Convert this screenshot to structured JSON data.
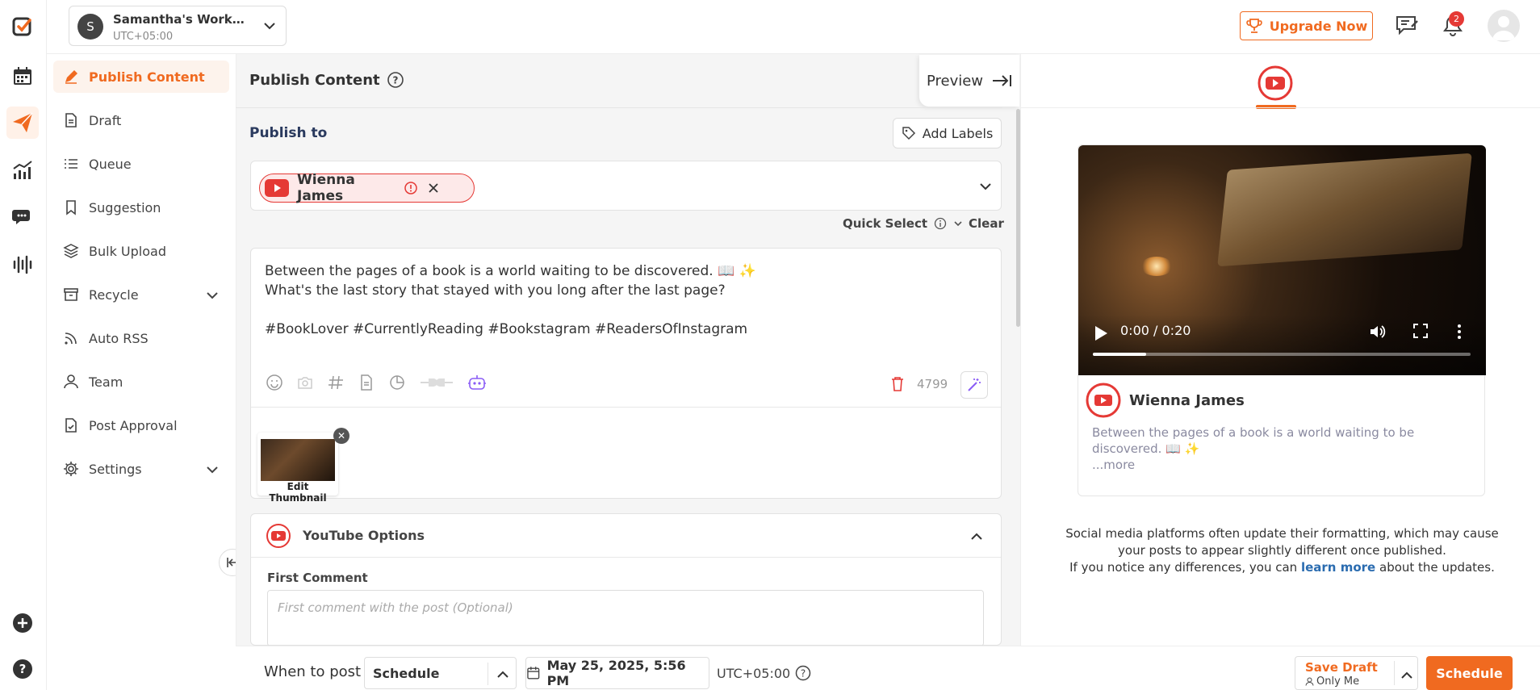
{
  "workspace": {
    "avatar_letter": "S",
    "name": "Samantha's Worksp...",
    "timezone": "UTC+05:00"
  },
  "header": {
    "upgrade_label": "Upgrade Now",
    "notification_count": "2"
  },
  "sidebar": {
    "items": [
      {
        "label": "Publish Content",
        "icon": "pencil-icon"
      },
      {
        "label": "Draft",
        "icon": "document-icon"
      },
      {
        "label": "Queue",
        "icon": "list-icon"
      },
      {
        "label": "Suggestion",
        "icon": "bookmark-icon"
      },
      {
        "label": "Bulk Upload",
        "icon": "layers-icon"
      },
      {
        "label": "Recycle",
        "icon": "archive-icon"
      },
      {
        "label": "Auto RSS",
        "icon": "rss-icon"
      },
      {
        "label": "Team",
        "icon": "user-icon"
      },
      {
        "label": "Post Approval",
        "icon": "doc-check-icon"
      },
      {
        "label": "Settings",
        "icon": "gear-icon"
      }
    ]
  },
  "compose": {
    "page_title": "Publish Content",
    "preview_label": "Preview",
    "publish_to_label": "Publish to",
    "add_labels": "Add Labels",
    "account_chip_name": "Wienna James",
    "quick_select": "Quick Select",
    "clear": "Clear",
    "post_text": "Between the pages of a book is a world waiting to be discovered. 📖 ✨\nWhat's the last story that stayed with you long after the last page?\n\n#BookLover #CurrentlyReading #Bookstagram #ReadersOfInstagram",
    "char_count": "4799",
    "edit_thumbnail": "Edit Thumbnail",
    "youtube_options": "YouTube Options",
    "first_comment_label": "First Comment",
    "first_comment_placeholder": "First comment with the post (Optional)"
  },
  "bottom": {
    "when_to_post": "When to post",
    "schedule_mode": "Schedule",
    "date": "May 25, 2025, 5:56 PM",
    "timezone": "UTC+05:00",
    "save_draft": "Save Draft",
    "visibility": "Only Me",
    "schedule_button": "Schedule"
  },
  "preview": {
    "video_time": "0:00 / 0:20",
    "video_progress": 0.14,
    "account_name": "Wienna James",
    "body": "Between the pages of a book is a world waiting to be discovered. 📖 ✨",
    "more": "...more",
    "note_line1": "Social media platforms often update their formatting, which may cause your posts to appear slightly different once published.",
    "note_line2_pre": "If you notice any differences, you can",
    "note_link": "learn more",
    "note_line2_post": "about the updates."
  },
  "colors": {
    "accent": "#f06a20",
    "youtube_red": "#e53935",
    "link_blue": "#2b6cb0"
  }
}
